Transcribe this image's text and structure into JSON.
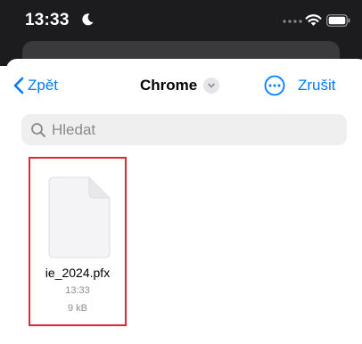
{
  "status_bar": {
    "time": "13:33",
    "icons": [
      "moon-icon",
      "signal-icon",
      "wifi-icon",
      "battery-icon"
    ]
  },
  "nav": {
    "back_label": "Zpět",
    "title": "Chrome",
    "more_icon": "ellipsis-circle-icon",
    "cancel_label": "Zrušit"
  },
  "search": {
    "placeholder": "Hledat",
    "value": ""
  },
  "files": [
    {
      "name": "ie_2024.pfx",
      "time": "13:33",
      "size": "9 kB",
      "icon": "document-icon"
    }
  ],
  "colors": {
    "accent": "#007aff",
    "selection_border": "#e0262f",
    "secondary_text": "#8e8e93",
    "status_bar_bg": "#1c1c1e"
  }
}
